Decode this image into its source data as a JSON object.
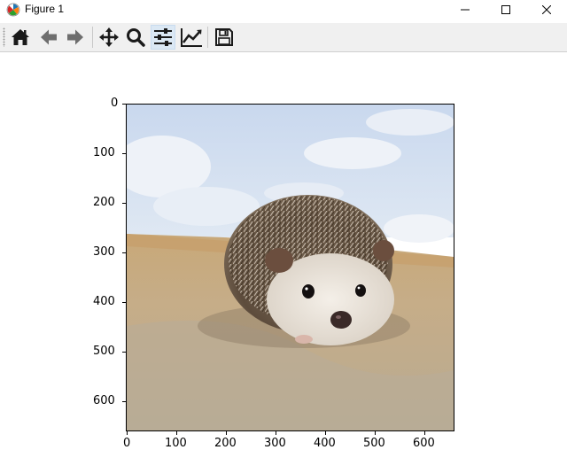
{
  "window": {
    "title": "Figure 1"
  },
  "toolbar": {
    "buttons": [
      {
        "name": "home",
        "icon": "home-icon"
      },
      {
        "name": "back",
        "icon": "arrow-left-icon"
      },
      {
        "name": "forward",
        "icon": "arrow-right-icon"
      },
      {
        "name": "pan",
        "icon": "move-icon"
      },
      {
        "name": "zoom",
        "icon": "magnifier-icon"
      },
      {
        "name": "configure-subplots",
        "icon": "sliders-icon",
        "active": true
      },
      {
        "name": "edit-axis",
        "icon": "line-chart-icon"
      },
      {
        "name": "save",
        "icon": "floppy-disk-icon"
      }
    ]
  },
  "axes": {
    "x_ticks": [
      "0",
      "100",
      "200",
      "300",
      "400",
      "500",
      "600"
    ],
    "y_ticks": [
      "0",
      "100",
      "200",
      "300",
      "400",
      "500",
      "600"
    ],
    "image_subject": "hedgehog-photo"
  }
}
